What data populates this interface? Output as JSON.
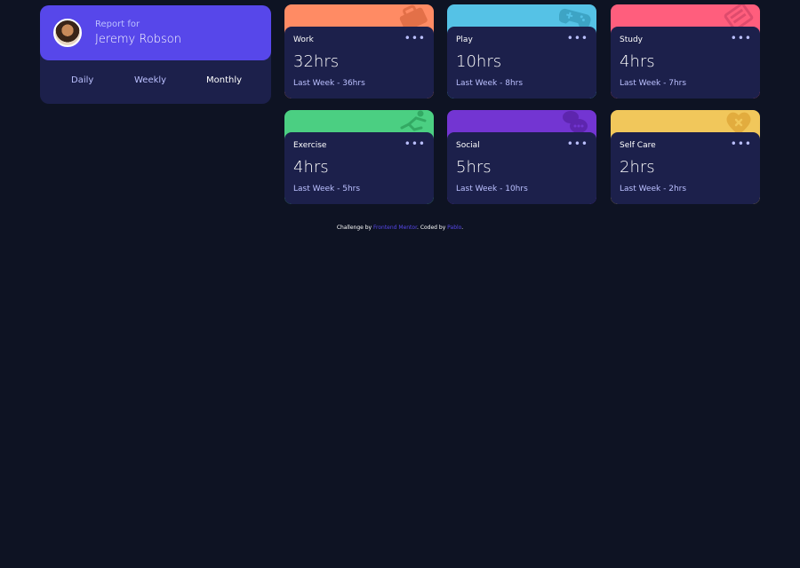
{
  "profile": {
    "report_for": "Report for",
    "name": "Jeremy Robson",
    "periods": [
      {
        "label": "Daily",
        "active": false
      },
      {
        "label": "Weekly",
        "active": false
      },
      {
        "label": "Monthly",
        "active": true
      }
    ]
  },
  "cards": [
    {
      "title": "Work",
      "hours": "32hrs",
      "previous": "Last Week - 36hrs",
      "color": "#ff8b64",
      "icon": "briefcase-icon",
      "menu": "•••"
    },
    {
      "title": "Play",
      "hours": "10hrs",
      "previous": "Last Week - 8hrs",
      "color": "#55c2e6",
      "icon": "gamepad-icon",
      "menu": "•••"
    },
    {
      "title": "Study",
      "hours": "4hrs",
      "previous": "Last Week - 7hrs",
      "color": "#ff5e7d",
      "icon": "book-icon",
      "menu": "•••"
    },
    {
      "title": "Exercise",
      "hours": "4hrs",
      "previous": "Last Week - 5hrs",
      "color": "#4bcf82",
      "icon": "running-person-icon",
      "menu": "•••"
    },
    {
      "title": "Social",
      "hours": "5hrs",
      "previous": "Last Week - 10hrs",
      "color": "#7335d2",
      "icon": "chat-bubbles-icon",
      "menu": "•••"
    },
    {
      "title": "Self Care",
      "hours": "2hrs",
      "previous": "Last Week - 2hrs",
      "color": "#f1c75b",
      "icon": "heart-icon",
      "menu": "•••"
    }
  ],
  "footer": {
    "prefix": "Challenge by ",
    "link1": "Frontend Mentor",
    "middle": ". Coded by ",
    "link2": "Pablo",
    "suffix": "."
  }
}
